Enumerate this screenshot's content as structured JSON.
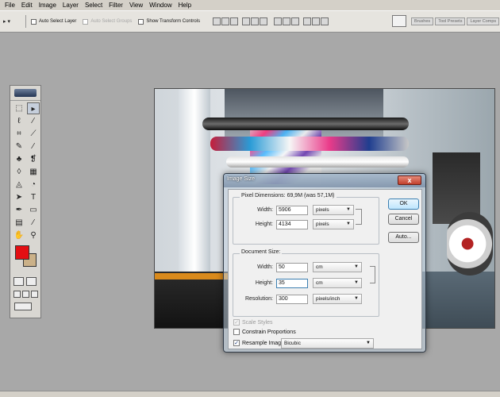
{
  "menubar": {
    "items": [
      "File",
      "Edit",
      "Image",
      "Layer",
      "Select",
      "Filter",
      "View",
      "Window",
      "Help"
    ]
  },
  "options_bar": {
    "auto_select_layer": "Auto Select Layer",
    "auto_select_groups": "Auto Select Groups",
    "show_transform_controls": "Show Transform Controls",
    "palette_tabs": [
      "Brushes",
      "Tool Presets",
      "Layer Comps"
    ]
  },
  "toolbox": {
    "foreground_color": "#e30f13",
    "background_color": "#cbb188",
    "tools": [
      "marquee-icon",
      "move-icon",
      "lasso-icon",
      "magic-wand-icon",
      "crop-icon",
      "slice-icon",
      "healing-brush-icon",
      "brush-icon",
      "clone-stamp-icon",
      "history-brush-icon",
      "eraser-icon",
      "gradient-icon",
      "blur-icon",
      "dodge-icon",
      "path-selection-icon",
      "type-icon",
      "pen-icon",
      "shape-icon",
      "notes-icon",
      "eyedropper-icon",
      "hand-icon",
      "zoom-icon"
    ]
  },
  "dialog": {
    "title": "Image Size",
    "pixel_dimensions_label": "Pixel Dimensions: 69,9M (was 57,1M)",
    "pixel_width_label": "Width:",
    "pixel_width_value": "5906",
    "pixel_width_unit": "pixels",
    "pixel_height_label": "Height:",
    "pixel_height_value": "4134",
    "pixel_height_unit": "pixels",
    "document_size_label": "Document Size:",
    "doc_width_label": "Width:",
    "doc_width_value": "50",
    "doc_width_unit": "cm",
    "doc_height_label": "Height:",
    "doc_height_value": "35",
    "doc_height_unit": "cm",
    "resolution_label": "Resolution:",
    "resolution_value": "300",
    "resolution_unit": "pixels/inch",
    "scale_styles_label": "Scale Styles",
    "constrain_proportions_label": "Constrain Proportions",
    "resample_image_label": "Resample Image:",
    "resample_method": "Bicubic",
    "ok_label": "OK",
    "cancel_label": "Cancel",
    "auto_label": "Auto...",
    "close_glyph": "x",
    "check_glyph": "✓"
  }
}
